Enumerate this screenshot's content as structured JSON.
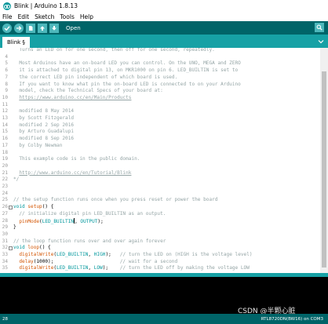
{
  "window": {
    "title": "Blink | Arduino 1.8.13"
  },
  "menu": [
    "File",
    "Edit",
    "Sketch",
    "Tools",
    "Help"
  ],
  "toolbar": {
    "verify_icon": "check-icon",
    "upload_icon": "arrow-right-icon",
    "new_icon": "file-new-icon",
    "open_icon": "arrow-up-icon",
    "save_icon": "arrow-down-icon",
    "hover_label": "Open",
    "serial_icon": "magnifier-icon"
  },
  "tabs": [
    {
      "label": "Blink §"
    }
  ],
  "editor": {
    "lines": [
      {
        "n": "",
        "fold": "",
        "segs": [
          {
            "t": "  Turns an LED on for one second, then off for one second, repeatedly.",
            "c": "comment"
          }
        ]
      },
      {
        "n": "4",
        "fold": "",
        "segs": []
      },
      {
        "n": "5",
        "fold": "",
        "segs": [
          {
            "t": "  Most Arduinos have an on-board LED you can control. On the UNO, MEGA and ZERO",
            "c": "comment"
          }
        ]
      },
      {
        "n": "6",
        "fold": "",
        "segs": [
          {
            "t": "  it is attached to digital pin 13, on MKR1000 on pin 6. LED_BUILTIN is set to",
            "c": "comment"
          }
        ]
      },
      {
        "n": "7",
        "fold": "",
        "segs": [
          {
            "t": "  the correct LED pin independent of which board is used.",
            "c": "comment"
          }
        ]
      },
      {
        "n": "8",
        "fold": "",
        "segs": [
          {
            "t": "  If you want to know what pin the on-board LED is connected to on your Arduino",
            "c": "comment"
          }
        ]
      },
      {
        "n": "9",
        "fold": "",
        "segs": [
          {
            "t": "  model, check the Technical Specs of your board at:",
            "c": "comment"
          }
        ]
      },
      {
        "n": "10",
        "fold": "",
        "segs": [
          {
            "t": "  ",
            "c": "comment"
          },
          {
            "t": "https://www.arduino.cc/en/Main/Products",
            "c": "link"
          }
        ]
      },
      {
        "n": "11",
        "fold": "",
        "segs": []
      },
      {
        "n": "12",
        "fold": "",
        "segs": [
          {
            "t": "  modified 8 May 2014",
            "c": "comment"
          }
        ]
      },
      {
        "n": "13",
        "fold": "",
        "segs": [
          {
            "t": "  by Scott Fitzgerald",
            "c": "comment"
          }
        ]
      },
      {
        "n": "14",
        "fold": "",
        "segs": [
          {
            "t": "  modified 2 Sep 2016",
            "c": "comment"
          }
        ]
      },
      {
        "n": "15",
        "fold": "",
        "segs": [
          {
            "t": "  by Arturo Guadalupi",
            "c": "comment"
          }
        ]
      },
      {
        "n": "16",
        "fold": "",
        "segs": [
          {
            "t": "  modified 8 Sep 2016",
            "c": "comment"
          }
        ]
      },
      {
        "n": "17",
        "fold": "",
        "segs": [
          {
            "t": "  by Colby Newman",
            "c": "comment"
          }
        ]
      },
      {
        "n": "18",
        "fold": "",
        "segs": []
      },
      {
        "n": "19",
        "fold": "",
        "segs": [
          {
            "t": "  This example code is in the public domain.",
            "c": "comment"
          }
        ]
      },
      {
        "n": "20",
        "fold": "",
        "segs": []
      },
      {
        "n": "21",
        "fold": "",
        "segs": [
          {
            "t": "  ",
            "c": "comment"
          },
          {
            "t": "http://www.arduino.cc/en/Tutorial/Blink",
            "c": "link"
          }
        ]
      },
      {
        "n": "22",
        "fold": "",
        "segs": [
          {
            "t": "*/",
            "c": "comment"
          }
        ]
      },
      {
        "n": "23",
        "fold": "",
        "segs": []
      },
      {
        "n": "24",
        "fold": "",
        "segs": []
      },
      {
        "n": "25",
        "fold": "",
        "segs": [
          {
            "t": "// the setup function runs once when you press reset or power the board",
            "c": "comment"
          }
        ]
      },
      {
        "n": "26",
        "fold": "−",
        "segs": [
          {
            "t": "void",
            "c": "keyword"
          },
          {
            "t": " ",
            "c": "sym"
          },
          {
            "t": "setup",
            "c": "func"
          },
          {
            "t": "() {",
            "c": "sym"
          }
        ]
      },
      {
        "n": "27",
        "fold": "",
        "segs": [
          {
            "t": "  // initialize digital pin LED_BUILTIN as an output.",
            "c": "comment"
          }
        ]
      },
      {
        "n": "28",
        "fold": "",
        "segs": [
          {
            "t": "  ",
            "c": "sym"
          },
          {
            "t": "pinMode",
            "c": "func"
          },
          {
            "t": "(",
            "c": "sym"
          },
          {
            "t": "LED_BUILTIN",
            "c": "const"
          },
          {
            "t": "|",
            "c": "cursor"
          },
          {
            "t": ", ",
            "c": "sym"
          },
          {
            "t": "OUTPUT",
            "c": "const"
          },
          {
            "t": ");",
            "c": "sym"
          }
        ]
      },
      {
        "n": "29",
        "fold": "",
        "segs": [
          {
            "t": "}",
            "c": "sym"
          }
        ]
      },
      {
        "n": "30",
        "fold": "",
        "segs": []
      },
      {
        "n": "31",
        "fold": "",
        "segs": [
          {
            "t": "// the loop function runs over and over again forever",
            "c": "comment"
          }
        ]
      },
      {
        "n": "32",
        "fold": "−",
        "segs": [
          {
            "t": "void",
            "c": "keyword"
          },
          {
            "t": " ",
            "c": "sym"
          },
          {
            "t": "loop",
            "c": "func"
          },
          {
            "t": "() {",
            "c": "sym"
          }
        ]
      },
      {
        "n": "33",
        "fold": "",
        "segs": [
          {
            "t": "  ",
            "c": "sym"
          },
          {
            "t": "digitalWrite",
            "c": "func"
          },
          {
            "t": "(",
            "c": "sym"
          },
          {
            "t": "LED_BUILTIN",
            "c": "const"
          },
          {
            "t": ", ",
            "c": "sym"
          },
          {
            "t": "HIGH",
            "c": "const"
          },
          {
            "t": ");   ",
            "c": "sym"
          },
          {
            "t": "// turn the LED on (HIGH is the voltage level)",
            "c": "comment"
          }
        ]
      },
      {
        "n": "34",
        "fold": "",
        "segs": [
          {
            "t": "  ",
            "c": "sym"
          },
          {
            "t": "delay",
            "c": "func"
          },
          {
            "t": "(1000);                       ",
            "c": "sym"
          },
          {
            "t": "// wait for a second",
            "c": "comment"
          }
        ]
      },
      {
        "n": "35",
        "fold": "",
        "segs": [
          {
            "t": "  ",
            "c": "sym"
          },
          {
            "t": "digitalWrite",
            "c": "func"
          },
          {
            "t": "(",
            "c": "sym"
          },
          {
            "t": "LED_BUILTIN",
            "c": "const"
          },
          {
            "t": ", ",
            "c": "sym"
          },
          {
            "t": "LOW",
            "c": "const"
          },
          {
            "t": ");    ",
            "c": "sym"
          },
          {
            "t": "// turn the LED off by making the voltage LOW",
            "c": "comment"
          }
        ]
      }
    ]
  },
  "watermark": "CSDN @半颗心脏",
  "status": {
    "line": "28",
    "board": "RTL8720DN(BW16) on COM3"
  },
  "colors": {
    "toolbar": "#006468",
    "tabbar": "#17a1a5",
    "button": "#4db7bb",
    "comment": "#95a5a6",
    "keyword": "#00979c",
    "function": "#d35400"
  }
}
